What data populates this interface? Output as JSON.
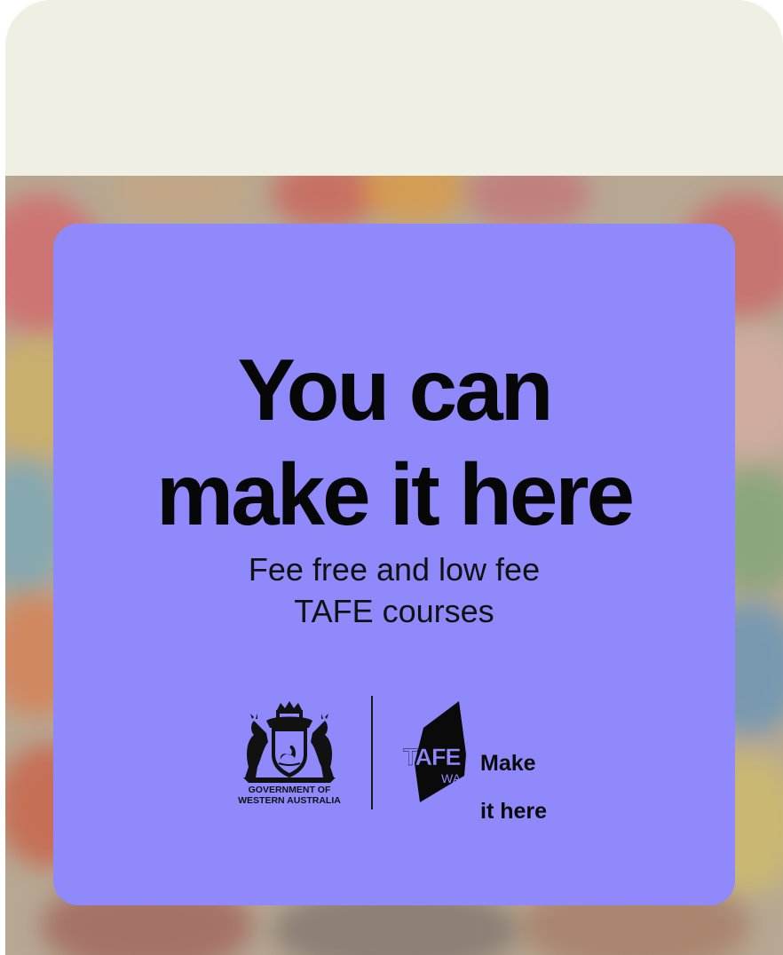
{
  "card": {
    "headline_line1": "You can",
    "headline_line2": "make it here",
    "subline_line1": "Fee free and low fee",
    "subline_line2": "TAFE courses",
    "background_color": "#8f89fc"
  },
  "logos": {
    "government": {
      "icon": "coat-of-arms-icon",
      "line1": "GOVERNMENT OF",
      "line2": "WESTERN AUSTRALIA"
    },
    "tafe": {
      "icon": "tafe-wa-logo-icon",
      "wordmark": "TAFE",
      "sub": "WA",
      "tagline_line1": "Make",
      "tagline_line2": "it here"
    }
  },
  "colors": {
    "page_top": "#efefe4",
    "card": "#8f89fc",
    "text": "#070707"
  }
}
